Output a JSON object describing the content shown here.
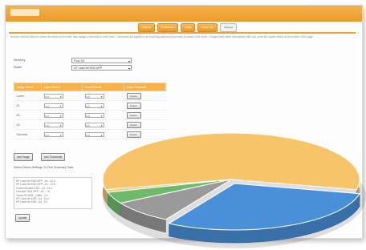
{
  "tabs": [
    {
      "label": "Analysis"
    },
    {
      "label": "Preferences"
    },
    {
      "label": "Alerts"
    },
    {
      "label": "Device Info"
    },
    {
      "label": "Settings",
      "active": true
    }
  ],
  "intro_text": "Use the controls below to select the device and model, then assign a threshold to each zone. Thresholds are applied to all incoming jobs and a summary is shown in the chart. Changes take effect immediately after you press the update button at the bottom of the page.",
  "form": {
    "directory": {
      "label": "Directory",
      "value": "Floor 1B"
    },
    "model": {
      "label": "Model",
      "value": "HP LaserJet 9050 MFP"
    }
  },
  "zone_table": {
    "headers": [
      "Range Name",
      "Upper Bound",
      "Lower Bound",
      "Clear Threshold"
    ],
    "rows": [
      {
        "zone": "Lorem",
        "upper": "0.0",
        "lower": "0.0",
        "action": "Delete"
      },
      {
        "zone": "A1",
        "upper": "0.0",
        "lower": "0.0",
        "action": "Delete"
      },
      {
        "zone": "A2",
        "upper": "0.0",
        "lower": "0.0",
        "action": "Delete"
      },
      {
        "zone": "A3",
        "upper": "0.0",
        "lower": "0.0",
        "action": "Delete"
      },
      {
        "zone": "Sub total",
        "upper": "0.0",
        "lower": "0.0",
        "action": "Delete"
      }
    ]
  },
  "buttons": {
    "add_range": "Add Range",
    "add_threshold": "Add Thresholds",
    "update": "Update"
  },
  "note": "Select Device Settings To Print Summary Data",
  "status_lines": [
    "HP LaserJet 9050 MFP - A4 - 40.0",
    "HP LaserJet 9050 MFP - A3 - 12.5",
    "Konica Minolta C451 - A4 - 18.0",
    "Lexmark T644 MFP - A4 - 7.5",
    "Canon iR 3025 - Letter - 3.0",
    "HP LaserJet 4250 - A4 - 10.0",
    "HP LaserJet 4350 - A4 - 9.0"
  ],
  "chart_data": {
    "type": "pie",
    "style": "3d-exploded",
    "values": [
      57,
      30,
      8,
      4,
      1
    ],
    "colors": [
      "#f7c46a",
      "#4a90d9",
      "#9a9a9a",
      "#6dbb6a",
      "#e8d08a"
    ],
    "exploded": [
      false,
      true,
      false,
      false,
      false
    ]
  }
}
